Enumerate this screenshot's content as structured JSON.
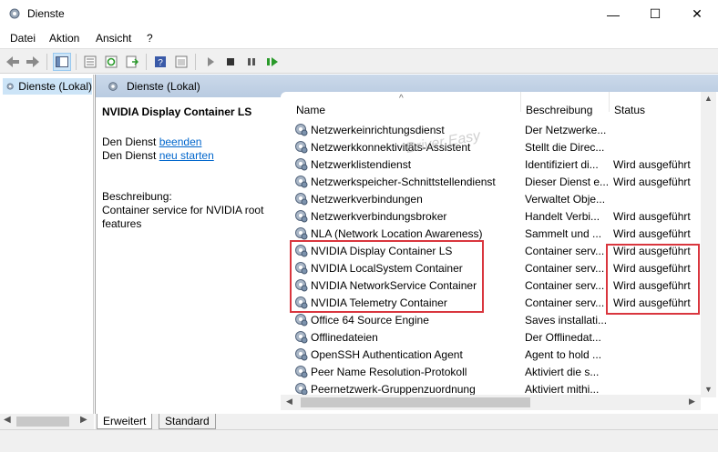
{
  "window": {
    "title": "Dienste",
    "minimize": "—",
    "maximize": "☐",
    "close": "✕"
  },
  "menu": [
    "Datei",
    "Aktion",
    "Ansicht",
    "?"
  ],
  "tree": {
    "item_label": "Dienste (Lokal)"
  },
  "header": {
    "label": "Dienste (Lokal)"
  },
  "detail": {
    "service_name": "NVIDIA Display Container LS",
    "stop_prefix": "Den Dienst ",
    "stop_link": "beenden",
    "restart_prefix": "Den Dienst ",
    "restart_link": "neu starten",
    "desc_label": "Beschreibung:",
    "desc_line1": "Container service for NVIDIA root",
    "desc_line2": "features"
  },
  "columns": {
    "name": "Name",
    "description": "Beschreibung",
    "status": "Status"
  },
  "rows": [
    {
      "name": "Netzwerkeinrichtungsdienst",
      "description": "Der Netzwerke...",
      "status": ""
    },
    {
      "name": "Netzwerkkonnektivitäts-Assistent",
      "description": "Stellt die Direc...",
      "status": ""
    },
    {
      "name": "Netzwerklistendienst",
      "description": "Identifiziert di...",
      "status": "Wird ausgeführt"
    },
    {
      "name": "Netzwerkspeicher-Schnittstellendienst",
      "description": "Dieser Dienst e...",
      "status": "Wird ausgeführt"
    },
    {
      "name": "Netzwerkverbindungen",
      "description": "Verwaltet Obje...",
      "status": ""
    },
    {
      "name": "Netzwerkverbindungsbroker",
      "description": "Handelt Verbi...",
      "status": "Wird ausgeführt"
    },
    {
      "name": "NLA (Network Location Awareness)",
      "description": "Sammelt und ...",
      "status": "Wird ausgeführt"
    },
    {
      "name": "NVIDIA Display Container LS",
      "description": "Container serv...",
      "status": "Wird ausgeführt"
    },
    {
      "name": "NVIDIA LocalSystem Container",
      "description": "Container serv...",
      "status": "Wird ausgeführt"
    },
    {
      "name": "NVIDIA NetworkService Container",
      "description": "Container serv...",
      "status": "Wird ausgeführt"
    },
    {
      "name": "NVIDIA Telemetry Container",
      "description": "Container serv...",
      "status": "Wird ausgeführt"
    },
    {
      "name": "Office 64 Source Engine",
      "description": "Saves installati...",
      "status": ""
    },
    {
      "name": "Offlinedateien",
      "description": "Der Offlinedat...",
      "status": ""
    },
    {
      "name": "OpenSSH Authentication Agent",
      "description": "Agent to hold ...",
      "status": ""
    },
    {
      "name": "Peer Name Resolution-Protokoll",
      "description": "Aktiviert die s...",
      "status": ""
    },
    {
      "name": "Peernetzwerk-Gruppenzuordnung",
      "description": "Aktiviert mithi...",
      "status": ""
    }
  ],
  "tabs": {
    "extended": "Erweitert",
    "standard": "Standard"
  },
  "watermark": "Driver Easy",
  "colors": {
    "highlight_box": "#d9363e",
    "header_band": "#c3d3e7",
    "link": "#0066cc"
  }
}
